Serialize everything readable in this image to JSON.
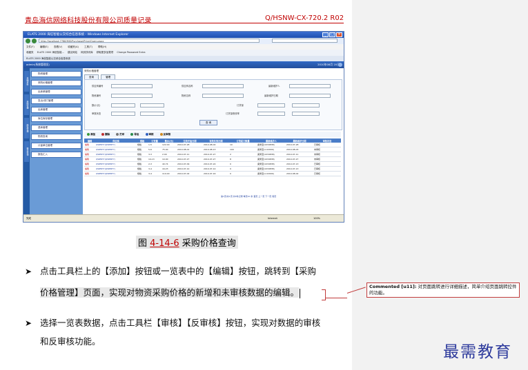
{
  "header": {
    "company_doc": "青岛海信网络科技股份有限公司质量记录",
    "doc_code": "Q/HSNW-CX-720.2 R02"
  },
  "screenshot": {
    "window_title": "ELATS 2000 海信智能公交综合信息系统 - Windows Internet Explorer",
    "url": "http://localhost:7788/MIS/Purchase/Price/Query.aspx",
    "menu": [
      "文件(F)",
      "编辑(E)",
      "查看(V)",
      "收藏夹(A)",
      "工具(T)",
      "帮助(H)"
    ],
    "favorites": [
      "收藏夹",
      "ELATS 2000 海信智能...",
      "建议网站",
      "网页快讯库",
      "获取更多加载项",
      "Change Password Extra"
    ],
    "tab_title": "ELATS 2000 海信智能公交综合信息系统",
    "app_user": "admin(系统管理员)",
    "app_date": "2010年08月 20日",
    "side_tabs": [
      "基础资料",
      "采购管理",
      "库存管理",
      "报表查询"
    ],
    "side_items": [
      "物资管理",
      "采购价格管理",
      "出库单管理",
      "发出/领门管理",
      "出库管理",
      "库位库存管理",
      "退库管理",
      "物资查询",
      "计量单位管理",
      "报检汇入"
    ],
    "breadcrumb": "采购价格管理",
    "subtabs": [
      "查询",
      "管理"
    ],
    "form_labels": [
      "供应商编号",
      "供应商名称",
      "最新维护人",
      "物资编号",
      "物资名称",
      "最新维护日期",
      "数价(元)",
      "数量(元)",
      "订货量",
      "审核状态",
      "订货量修改率"
    ],
    "query_button": "查 询",
    "toolbar": [
      "添加",
      "删除",
      "打印",
      "导出",
      "审核",
      "反审核"
    ],
    "grid_headers": [
      "编辑",
      "供应商",
      "规格",
      "订货量",
      "数价(元)",
      "生效开始日期",
      "有效失效日期",
      "订货起订数量",
      "最新维护人",
      "最新维护日期",
      "审核状态"
    ],
    "grid_rows": [
      [
        "编辑",
        "QWERTY(QWERTY)",
        "规格",
        "1-5",
        "122.00",
        "2010-07-28",
        "2014-08-02",
        "10",
        "梁秀莹(1034838)",
        "2010-07-28",
        "已审核"
      ],
      [
        "编辑",
        "QWERTY(QWERTY)",
        "规格",
        "5-6",
        "75.00",
        "2010-08-01",
        "2010-08-13",
        "100",
        "梁秀莹(1-02009)",
        "2010-08-03",
        "未审核"
      ],
      [
        "编辑",
        "QWERTY(QWERTY)",
        "规格",
        "3-3",
        "2.00",
        "2010-07-11",
        "2010-07-27",
        "2",
        "梁秀莹(1034838)",
        "2010-07-11",
        "未审核"
      ],
      [
        "编辑",
        "QWERTY(QWERTY)",
        "规格",
        "10-13",
        "10.00",
        "2010-07-27",
        "2010-07-27",
        "8",
        "梁秀莹(1034838)",
        "2010-07-27",
        "未审核"
      ],
      [
        "编辑",
        "QWERTY(QWERTY)",
        "规格",
        "2-3",
        "40.74",
        "2010-07-09",
        "2010-07-24",
        "0",
        "梁秀莹(1034838)",
        "2010-07-13",
        "已审核"
      ],
      [
        "编辑",
        "QWERTY(QWERTY)",
        "规格",
        "3-4",
        "44.23",
        "2010-07-12",
        "2010-07-14",
        "0",
        "梁秀莹(1034838)",
        "2010-07-13",
        "已审核"
      ],
      [
        "编辑",
        "QWERTY(QWERTY)",
        "规格",
        "3-4",
        "110.00",
        "2010-07-02",
        "2010-07-16",
        "0",
        "梁秀莹(1-02009)",
        "2010-08-02",
        "已审核"
      ]
    ],
    "pager": "第1页/共1页 共8条记录 每页10 条 首页 上一页 下一页 尾页",
    "status_left": "完成",
    "status_zone": "Internet",
    "status_zoom": "100%"
  },
  "caption": {
    "prefix": "图 ",
    "number": "4-14-6",
    "text": " 采购价格查询"
  },
  "paragraphs": {
    "p1_line1": "点击工具栏上的【添加】按钮或一览表中的【编辑】按钮，跳转到【采购",
    "p1_line2": "价格管理】页面，实现对物资采购价格的新增和未审核数据的编辑。",
    "p2_line1": "选择一览表数据，点击工具栏【审核】【反审核】按钮，实现对数据的审核",
    "p2_line2": "和反审核功能。"
  },
  "comment": {
    "label": "Commented [u11]:",
    "text": "对页面跳转进行详细描述，简单介绍页面跳转控件的功能。"
  },
  "brand": "最需教育"
}
